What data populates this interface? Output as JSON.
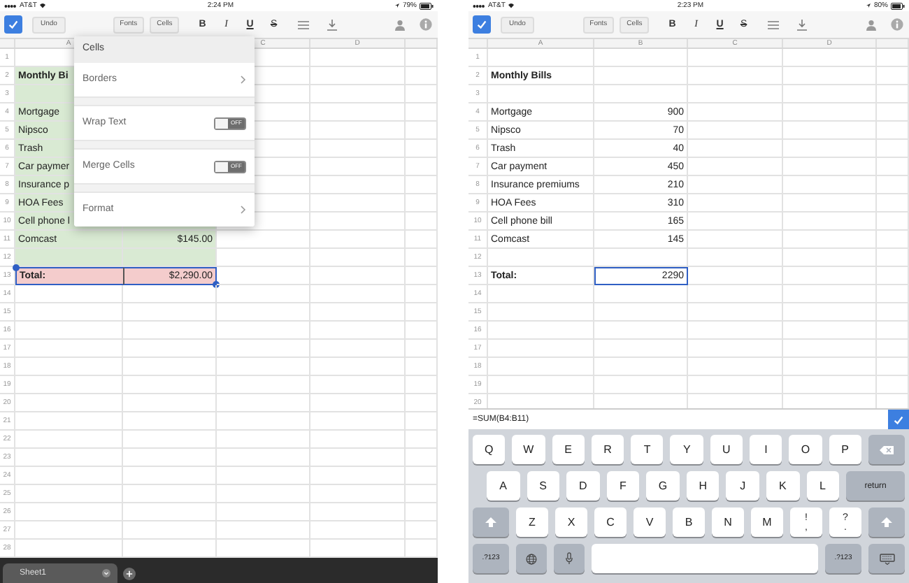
{
  "screens": [
    {
      "status_bar": {
        "carrier": "AT&T",
        "time": "2:24 PM",
        "battery": "79%"
      },
      "toolbar": {
        "undo": "Undo",
        "menus": [
          "Fonts",
          "Cells"
        ],
        "format_buttons": [
          {
            "kind": "bold",
            "label": "B"
          },
          {
            "kind": "italic",
            "label": "I"
          },
          {
            "kind": "underline",
            "label": "U"
          },
          {
            "kind": "strike",
            "label": "S"
          }
        ]
      },
      "column_headers": {
        "a": "A",
        "c": "C",
        "d": "D"
      },
      "selection_handles": true,
      "rows": [
        {
          "number": "1"
        },
        {
          "number": "2",
          "color": "#d9ead3",
          "cells": [
            {
              "text": "Monthly Bi",
              "bold": true,
              "selected": false
            },
            null
          ]
        },
        {
          "number": "3",
          "color": "#d9ead3"
        },
        {
          "number": "4",
          "color": "#d9ead3",
          "cells": [
            {
              "text": "Mortgage",
              "bold": false,
              "selected": false
            },
            null
          ]
        },
        {
          "number": "5",
          "color": "#d9ead3",
          "cells": [
            {
              "text": "Nipsco",
              "bold": false,
              "selected": false
            },
            null
          ]
        },
        {
          "number": "6",
          "color": "#d9ead3",
          "cells": [
            {
              "text": "Trash",
              "bold": false,
              "selected": false
            },
            null
          ]
        },
        {
          "number": "7",
          "color": "#d9ead3",
          "cells": [
            {
              "text": "Car paymer",
              "bold": false,
              "selected": false
            },
            null
          ]
        },
        {
          "number": "8",
          "color": "#d9ead3",
          "cells": [
            {
              "text": "Insurance p",
              "bold": false,
              "selected": false
            },
            null
          ]
        },
        {
          "number": "9",
          "color": "#d9ead3",
          "cells": [
            {
              "text": "HOA Fees",
              "bold": false,
              "selected": false
            },
            null
          ]
        },
        {
          "number": "10",
          "color": "#d9ead3",
          "cells": [
            {
              "text": "Cell phone l",
              "bold": false,
              "selected": false
            },
            null
          ]
        },
        {
          "number": "11",
          "color": "#d9ead3",
          "cells": [
            {
              "text": "Comcast",
              "bold": false,
              "selected": false
            },
            {
              "text": "$145.00",
              "bold": false,
              "selected": false
            }
          ]
        },
        {
          "number": "12",
          "color": "#d9ead3"
        },
        {
          "number": "13",
          "color": "#f4cccc",
          "cells": [
            {
              "text": "Total:",
              "bold": true,
              "selected": true
            },
            {
              "text": "$2,290.00",
              "bold": false,
              "selected": true
            }
          ]
        },
        {
          "number": "14"
        },
        {
          "number": "15"
        },
        {
          "number": "16"
        },
        {
          "number": "17"
        },
        {
          "number": "18"
        },
        {
          "number": "19"
        },
        {
          "number": "20"
        },
        {
          "number": "21"
        },
        {
          "number": "22"
        },
        {
          "number": "23"
        },
        {
          "number": "24"
        },
        {
          "number": "25"
        },
        {
          "number": "26"
        },
        {
          "number": "27"
        },
        {
          "number": "28"
        }
      ],
      "popover": [
        {
          "kind": "header",
          "label": "Cells"
        },
        {
          "kind": "link",
          "label": "Borders"
        },
        {
          "kind": "toggle",
          "label": "Wrap Text",
          "on": false,
          "state_label": "OFF"
        },
        {
          "kind": "toggle",
          "label": "Merge Cells",
          "on": false,
          "state_label": "OFF"
        },
        {
          "kind": "link",
          "label": "Format"
        }
      ],
      "sheet_tabs": [
        {
          "label": "Sheet1",
          "selected": true
        }
      ]
    },
    {
      "status_bar": {
        "carrier": "AT&T",
        "time": "2:23 PM",
        "battery": "80%"
      },
      "toolbar": {
        "undo": "Undo",
        "menus": [
          "Fonts",
          "Cells"
        ],
        "format_buttons": [
          {
            "kind": "bold",
            "label": "B"
          },
          {
            "kind": "italic",
            "label": "I"
          },
          {
            "kind": "underline",
            "label": "U"
          },
          {
            "kind": "strike",
            "label": "S"
          }
        ]
      },
      "column_headers": {
        "a": "A",
        "b": "B",
        "c": "C",
        "d": "D"
      },
      "rows": [
        {
          "number": "1"
        },
        {
          "number": "2",
          "cells": [
            {
              "text": "Monthly Bills",
              "bold": true,
              "selected": false
            },
            null
          ]
        },
        {
          "number": "3"
        },
        {
          "number": "4",
          "cells": [
            {
              "text": "Mortgage",
              "bold": false,
              "selected": false
            },
            {
              "text": "900",
              "bold": false,
              "selected": false
            }
          ]
        },
        {
          "number": "5",
          "cells": [
            {
              "text": "Nipsco",
              "bold": false,
              "selected": false
            },
            {
              "text": "70",
              "bold": false,
              "selected": false
            }
          ]
        },
        {
          "number": "6",
          "cells": [
            {
              "text": "Trash",
              "bold": false,
              "selected": false
            },
            {
              "text": "40",
              "bold": false,
              "selected": false
            }
          ]
        },
        {
          "number": "7",
          "cells": [
            {
              "text": "Car payment",
              "bold": false,
              "selected": false
            },
            {
              "text": "450",
              "bold": false,
              "selected": false
            }
          ]
        },
        {
          "number": "8",
          "cells": [
            {
              "text": "Insurance premiums",
              "bold": false,
              "selected": false
            },
            {
              "text": "210",
              "bold": false,
              "selected": false
            }
          ]
        },
        {
          "number": "9",
          "cells": [
            {
              "text": "HOA Fees",
              "bold": false,
              "selected": false
            },
            {
              "text": "310",
              "bold": false,
              "selected": false
            }
          ]
        },
        {
          "number": "10",
          "cells": [
            {
              "text": "Cell phone bill",
              "bold": false,
              "selected": false
            },
            {
              "text": "165",
              "bold": false,
              "selected": false
            }
          ]
        },
        {
          "number": "11",
          "cells": [
            {
              "text": "Comcast",
              "bold": false,
              "selected": false
            },
            {
              "text": "145",
              "bold": false,
              "selected": false
            }
          ]
        },
        {
          "number": "12"
        },
        {
          "number": "13",
          "cells": [
            {
              "text": "Total:",
              "bold": true,
              "selected": false
            },
            {
              "text": "2290",
              "bold": false,
              "selected": true
            }
          ]
        },
        {
          "number": "14"
        },
        {
          "number": "15"
        },
        {
          "number": "16"
        },
        {
          "number": "17"
        },
        {
          "number": "18"
        },
        {
          "number": "19"
        },
        {
          "number": "20"
        }
      ],
      "formula_bar": {
        "text": "=SUM(B4:B11)"
      },
      "keyboard": [
        [
          {
            "kind": "letter",
            "label": "Q"
          },
          {
            "kind": "letter",
            "label": "W"
          },
          {
            "kind": "letter",
            "label": "E"
          },
          {
            "kind": "letter",
            "label": "R"
          },
          {
            "kind": "letter",
            "label": "T"
          },
          {
            "kind": "letter",
            "label": "Y"
          },
          {
            "kind": "letter",
            "label": "U"
          },
          {
            "kind": "letter",
            "label": "I"
          },
          {
            "kind": "letter",
            "label": "O"
          },
          {
            "kind": "letter",
            "label": "P"
          },
          {
            "kind": "backspace"
          }
        ],
        [
          {
            "kind": "letter",
            "label": "A"
          },
          {
            "kind": "letter",
            "label": "S"
          },
          {
            "kind": "letter",
            "label": "D"
          },
          {
            "kind": "letter",
            "label": "F"
          },
          {
            "kind": "letter",
            "label": "G"
          },
          {
            "kind": "letter",
            "label": "H"
          },
          {
            "kind": "letter",
            "label": "J"
          },
          {
            "kind": "letter",
            "label": "K"
          },
          {
            "kind": "letter",
            "label": "L"
          },
          {
            "kind": "return",
            "label": "return"
          }
        ],
        [
          {
            "kind": "shift"
          },
          {
            "kind": "letter",
            "label": "Z"
          },
          {
            "kind": "letter",
            "label": "X"
          },
          {
            "kind": "letter",
            "label": "C"
          },
          {
            "kind": "letter",
            "label": "V"
          },
          {
            "kind": "letter",
            "label": "B"
          },
          {
            "kind": "letter",
            "label": "N"
          },
          {
            "kind": "letter",
            "label": "M"
          },
          {
            "kind": "punct",
            "label": "!",
            "sub": ","
          },
          {
            "kind": "punct",
            "label": "?",
            "sub": "."
          },
          {
            "kind": "shift"
          }
        ],
        [
          {
            "kind": "numbers",
            "label": ".?123"
          },
          {
            "kind": "globe"
          },
          {
            "kind": "mic"
          },
          {
            "kind": "space"
          },
          {
            "kind": "numbers",
            "label": ".?123"
          },
          {
            "kind": "hide"
          }
        ]
      ]
    }
  ]
}
